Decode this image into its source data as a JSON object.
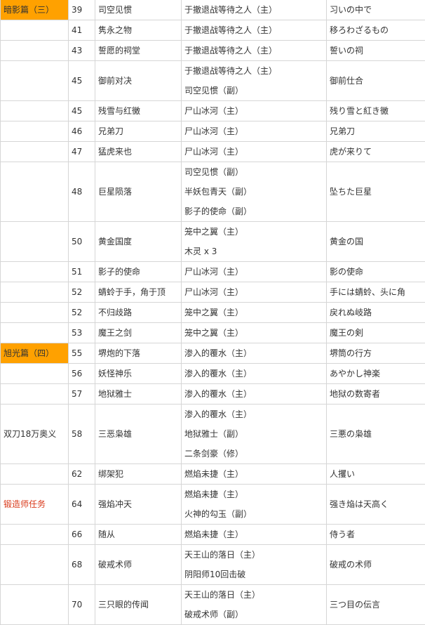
{
  "rows": [
    {
      "cat": "暗影篇（三）",
      "cat_style": "orange",
      "num": "39",
      "title": "司空见惯",
      "conds": [
        "于撤退战等待之人（主）"
      ],
      "jp": "习いの中で"
    },
    {
      "cat": "",
      "num": "41",
      "title": "隽永之物",
      "conds": [
        "于撤退战等待之人（主）"
      ],
      "jp": "移ろわざるもの"
    },
    {
      "cat": "",
      "num": "43",
      "title": "誓愿的祠堂",
      "conds": [
        "于撤退战等待之人（主）"
      ],
      "jp": "誓いの祠"
    },
    {
      "cat": "",
      "num": "45",
      "title": "御前对决",
      "conds": [
        "于撤退战等待之人（主）",
        "司空见惯（副）"
      ],
      "jp": "御前仕合"
    },
    {
      "cat": "",
      "num": "45",
      "title": "残雪与红黴",
      "conds": [
        "尸山冰河（主）"
      ],
      "jp": "残り雪と紅き黴"
    },
    {
      "cat": "",
      "num": "46",
      "title": "兄弟刀",
      "conds": [
        "尸山冰河（主）"
      ],
      "jp": "兄弟刀"
    },
    {
      "cat": "",
      "num": "47",
      "title": "猛虎来也",
      "conds": [
        "尸山冰河（主）"
      ],
      "jp": "虎が来りて"
    },
    {
      "cat": "",
      "num": "48",
      "title": "巨星陨落",
      "conds": [
        "司空见惯（副）",
        "半妖包青天（副）",
        "影子的使命（副）"
      ],
      "jp": "坠ちた巨星"
    },
    {
      "cat": "",
      "num": "50",
      "title": "黄金国度",
      "conds": [
        "笼中之翼（主）",
        "木灵 x 3"
      ],
      "jp": "黄金の国"
    },
    {
      "cat": "",
      "num": "51",
      "title": "影子的使命",
      "conds": [
        "尸山冰河（主）"
      ],
      "jp": "影の使命"
    },
    {
      "cat": "",
      "num": "52",
      "title": "蜻蛉于手，角于顶",
      "conds": [
        "尸山冰河（主）"
      ],
      "jp": "手には蜻蛉、头に角"
    },
    {
      "cat": "",
      "num": "52",
      "title": "不归歧路",
      "conds": [
        "笼中之翼（主）"
      ],
      "jp": "戻れぬ岐路"
    },
    {
      "cat": "",
      "num": "53",
      "title": "魔王之剑",
      "conds": [
        "笼中之翼（主）"
      ],
      "jp": "魔王の剣"
    },
    {
      "cat": "旭光篇（四）",
      "cat_style": "orange",
      "num": "55",
      "title": "堺炮的下落",
      "conds": [
        "渗入的覆水（主）"
      ],
      "jp": "堺筒の行方"
    },
    {
      "cat": "",
      "num": "56",
      "title": "妖怪神乐",
      "conds": [
        "渗入的覆水（主）"
      ],
      "jp": "あやかし神楽"
    },
    {
      "cat": "",
      "num": "57",
      "title": "地狱雅士",
      "conds": [
        "渗入的覆水（主）"
      ],
      "jp": "地狱の数寄者"
    },
    {
      "cat": "双刀18万奥义",
      "cat_style": "plain",
      "num": "58",
      "title": "三恶枭雄",
      "conds": [
        "渗入的覆水（主）",
        "地狱雅士（副）",
        "二条剑豪（修）"
      ],
      "jp": "三悪の枭雄"
    },
    {
      "cat": "",
      "num": "62",
      "title": "绑架犯",
      "conds": [
        "燃焰未捷（主）"
      ],
      "jp": "人攫い"
    },
    {
      "cat": "锻造师任务",
      "cat_style": "red",
      "num": "64",
      "title": "强焰冲天",
      "conds": [
        "燃焰未捷（主）",
        "火神的勾玉（副）"
      ],
      "jp": "强き焔は天高く"
    },
    {
      "cat": "",
      "num": "66",
      "title": "随从",
      "conds": [
        "燃焰未捷（主）"
      ],
      "jp": "侍う者"
    },
    {
      "cat": "",
      "num": "68",
      "title": "破戒术师",
      "conds": [
        "天王山的落日（主）",
        "阴阳师10回击破"
      ],
      "jp": "破戒の术师"
    },
    {
      "cat": "",
      "num": "70",
      "title": "三只眼的传闻",
      "conds": [
        "天王山的落日（主）",
        "破戒术师（副）"
      ],
      "jp": "三つ目の伝言"
    }
  ]
}
